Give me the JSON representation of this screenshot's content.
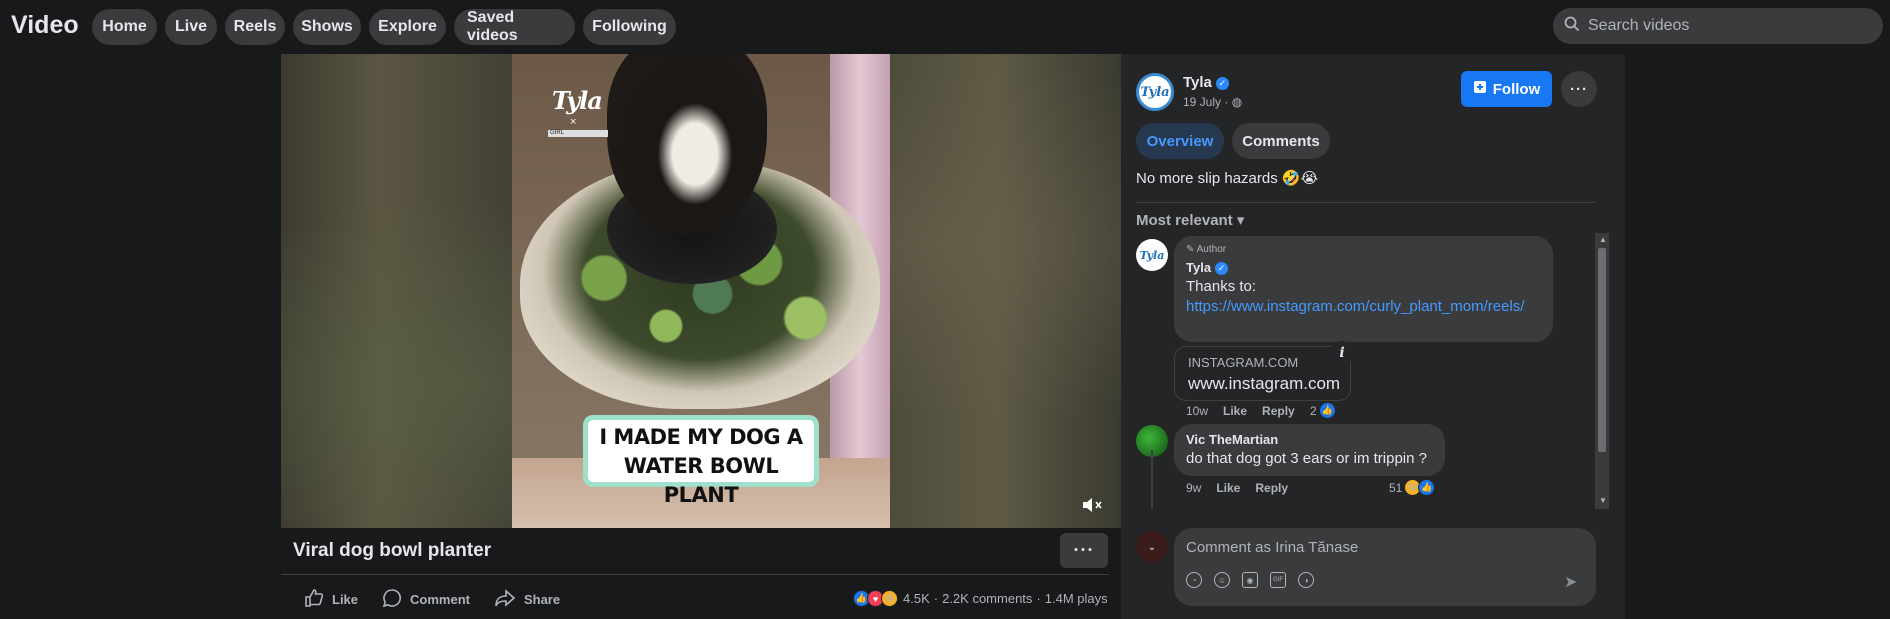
{
  "app": {
    "title": "Video"
  },
  "nav": {
    "items": [
      "Home",
      "Live",
      "Reels",
      "Shows",
      "Explore",
      "Saved videos",
      "Following"
    ]
  },
  "search": {
    "placeholder": "Search videos"
  },
  "video": {
    "overlay_logo": "Tyla",
    "overlay_x": "×",
    "overlay_sub": "GIRL",
    "caption_line1": "I MADE MY DOG A",
    "caption_line2": "WATER BOWL PLANT",
    "title": "Viral dog bowl planter",
    "more_label": "···",
    "actions": {
      "like": "Like",
      "comment": "Comment",
      "share": "Share"
    },
    "stats": {
      "reactions": "4.5K",
      "comments": "2.2K comments",
      "plays": "1.4M plays",
      "sep": "·"
    }
  },
  "panel": {
    "page_name": "Tyla",
    "date": "19 July · ",
    "follow_label": "Follow",
    "more_label": "···",
    "tabs": [
      {
        "label": "Overview",
        "active": true
      },
      {
        "label": "Comments",
        "active": false
      }
    ],
    "description": "No more slip hazards 🤣😭",
    "sort_label": "Most relevant",
    "comments": [
      {
        "badge": "Author",
        "author": "Tyla",
        "text": "Thanks to:",
        "link": "https://www.instagram.com/curly_plant_mom/reels/",
        "link_card": {
          "domain": "INSTAGRAM.COM",
          "url": "www.instagram.com"
        },
        "time": "10w",
        "like": "Like",
        "reply": "Reply",
        "reactions": "2"
      },
      {
        "author": "Vic TheMartian",
        "text": "do that dog got 3 ears or im trippin ?",
        "time": "9w",
        "like": "Like",
        "reply": "Reply",
        "reactions": "51"
      }
    ],
    "comment_input": {
      "placeholder": "Comment as Irina Tănase"
    }
  },
  "colors": {
    "accent": "#1877f2",
    "link": "#4599ff",
    "background": "#18191a",
    "panel": "#242526"
  }
}
